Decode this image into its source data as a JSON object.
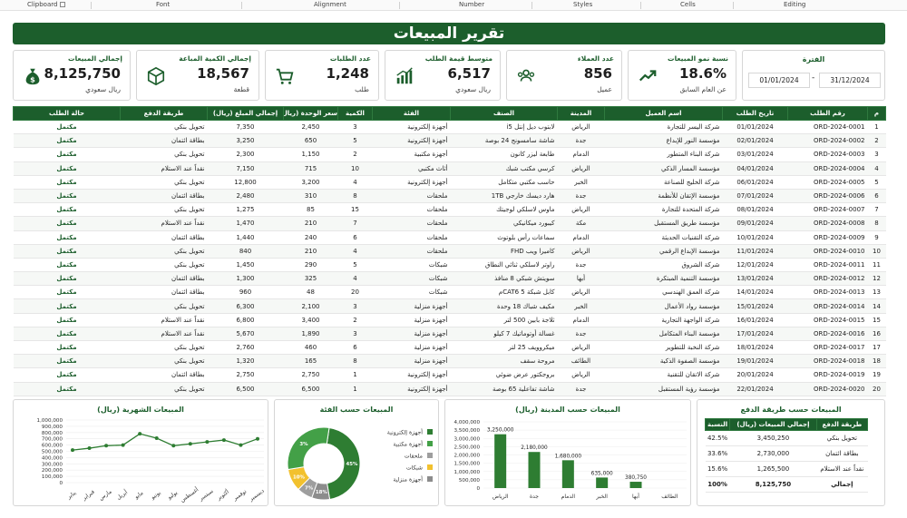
{
  "ribbon": [
    "Clipboard",
    "Font",
    "Alignment",
    "Number",
    "Styles",
    "Cells",
    "Editing"
  ],
  "title": "تقرير المبيعات",
  "period": {
    "label": "الفترة",
    "from": "01/01/2024",
    "to": "31/12/2024",
    "dash": "-"
  },
  "kpis": [
    {
      "title": "نسبة نمو المبيعات",
      "value": "18.6%",
      "sub": "عن العام السابق",
      "icon": "trend-up-icon"
    },
    {
      "title": "عدد العملاء",
      "value": "856",
      "sub": "عميل",
      "icon": "users-icon"
    },
    {
      "title": "متوسط قيمة الطلب",
      "value": "6,517",
      "sub": "ريال سعودي",
      "icon": "bar-trend-icon"
    },
    {
      "title": "عدد الطلبات",
      "value": "1,248",
      "sub": "طلب",
      "icon": "cart-icon"
    },
    {
      "title": "إجمالي الكمية المباعة",
      "value": "18,567",
      "sub": "قطعة",
      "icon": "box-icon"
    },
    {
      "title": "إجمالي المبيعات",
      "value": "8,125,750",
      "sub": "ريال سعودي",
      "icon": "money-bag-icon"
    }
  ],
  "table": {
    "headers": [
      "م",
      "رقم الطلب",
      "تاريخ الطلب",
      "اسم العميل",
      "المدينة",
      "الصنف",
      "الفئة",
      "الكمية",
      "سعر الوحدة (ريال)",
      "إجمالي المبلغ (ريال)",
      "طريقة الدفع",
      "حالة الطلب"
    ],
    "rows": [
      [
        "1",
        "ORD-2024-0001",
        "01/01/2024",
        "شركة اليسر للتجارة",
        "الرياض",
        "لابتوب ديل إنتل i5",
        "أجهزة إلكترونية",
        "3",
        "2,450",
        "7,350",
        "تحويل بنكي",
        "مكتمل"
      ],
      [
        "2",
        "ORD-2024-0002",
        "02/01/2024",
        "مؤسسة النور للإبداع",
        "جدة",
        "شاشة سامسونج 24 بوصة",
        "أجهزة إلكترونية",
        "5",
        "650",
        "3,250",
        "بطاقة ائتمان",
        "مكتمل"
      ],
      [
        "3",
        "ORD-2024-0003",
        "03/01/2024",
        "شركة البناء المتطور",
        "الدمام",
        "طابعة ليزر كانون",
        "أجهزة مكتبية",
        "2",
        "1,150",
        "2,300",
        "تحويل بنكي",
        "مكتمل"
      ],
      [
        "4",
        "ORD-2024-0004",
        "04/01/2024",
        "مؤسسة المسار الذكي",
        "الرياض",
        "كرسي مكتب شبك",
        "أثاث مكتبي",
        "10",
        "715",
        "7,150",
        "نقداً عند الاستلام",
        "مكتمل"
      ],
      [
        "5",
        "ORD-2024-0005",
        "06/01/2024",
        "شركة الخليج للصناعة",
        "الخبر",
        "حاسب مكتبي متكامل",
        "أجهزة إلكترونية",
        "4",
        "3,200",
        "12,800",
        "تحويل بنكي",
        "مكتمل"
      ],
      [
        "6",
        "ORD-2024-0006",
        "07/01/2024",
        "مؤسسة الإتقان للأنظمة",
        "جدة",
        "هارد ديسك خارجي 1TB",
        "ملحقات",
        "8",
        "310",
        "2,480",
        "بطاقة ائتمان",
        "مكتمل"
      ],
      [
        "7",
        "ORD-2024-0007",
        "08/01/2024",
        "شركة المتحدة للتجارة",
        "الرياض",
        "ماوس لاسلكي لوجيتك",
        "ملحقات",
        "15",
        "85",
        "1,275",
        "تحويل بنكي",
        "مكتمل"
      ],
      [
        "8",
        "ORD-2024-0008",
        "09/01/2024",
        "مؤسسة طريق المستقبل",
        "مكة",
        "كيبورد ميكانيكي",
        "ملحقات",
        "7",
        "210",
        "1,470",
        "نقداً عند الاستلام",
        "مكتمل"
      ],
      [
        "9",
        "ORD-2024-0009",
        "10/01/2024",
        "شركة التقنيات الحديثة",
        "الدمام",
        "سماعات رأس بلوتوث",
        "ملحقات",
        "6",
        "240",
        "1,440",
        "بطاقة ائتمان",
        "مكتمل"
      ],
      [
        "10",
        "ORD-2024-0010",
        "11/01/2024",
        "مؤسسة الإبداع الرقمي",
        "الرياض",
        "كاميرا ويب FHD",
        "ملحقات",
        "4",
        "210",
        "840",
        "تحويل بنكي",
        "مكتمل"
      ],
      [
        "11",
        "ORD-2024-0011",
        "12/01/2024",
        "شركة الشروق",
        "جدة",
        "راوتر لاسلكي ثنائي النطاق",
        "شبكات",
        "5",
        "290",
        "1,450",
        "تحويل بنكي",
        "مكتمل"
      ],
      [
        "12",
        "ORD-2024-0012",
        "13/01/2024",
        "مؤسسة التنمية المبتكرة",
        "أبها",
        "سويتش شبكي 8 منافذ",
        "شبكات",
        "4",
        "325",
        "1,300",
        "بطاقة ائتمان",
        "مكتمل"
      ],
      [
        "13",
        "ORD-2024-0013",
        "14/01/2024",
        "شركة العمق الهندسي",
        "الرياض",
        "كابل شبكة CAT6 5م",
        "شبكات",
        "20",
        "48",
        "960",
        "بطاقة ائتمان",
        "مكتمل"
      ],
      [
        "14",
        "ORD-2024-0014",
        "15/01/2024",
        "مؤسسة رواد الأعمال",
        "الخبر",
        "مكيف شباك 18 وحدة",
        "أجهزة منزلية",
        "3",
        "2,100",
        "6,300",
        "تحويل بنكي",
        "مكتمل"
      ],
      [
        "15",
        "ORD-2024-0015",
        "16/01/2024",
        "شركة الواجهة التجارية",
        "الدمام",
        "ثلاجة بابين 500 لتر",
        "أجهزة منزلية",
        "2",
        "3,400",
        "6,800",
        "نقداً عند الاستلام",
        "مكتمل"
      ],
      [
        "16",
        "ORD-2024-0016",
        "17/01/2024",
        "مؤسسة البناء المتكامل",
        "جدة",
        "غسالة أوتوماتيك 7 كيلو",
        "أجهزة منزلية",
        "3",
        "1,890",
        "5,670",
        "نقداً عند الاستلام",
        "مكتمل"
      ],
      [
        "17",
        "ORD-2024-0017",
        "18/01/2024",
        "شركة النخبة للتطوير",
        "الرياض",
        "ميكروويف 25 لتر",
        "أجهزة منزلية",
        "6",
        "460",
        "2,760",
        "تحويل بنكي",
        "مكتمل"
      ],
      [
        "18",
        "ORD-2024-0018",
        "19/01/2024",
        "مؤسسة الصفوة الذكية",
        "الطائف",
        "مروحة سقف",
        "أجهزة منزلية",
        "8",
        "165",
        "1,320",
        "تحويل بنكي",
        "مكتمل"
      ],
      [
        "19",
        "ORD-2024-0019",
        "20/01/2024",
        "شركة الاتقان للتقنية",
        "الرياض",
        "بروجكتور عرض ضوئي",
        "أجهزة إلكترونية",
        "1",
        "2,750",
        "2,750",
        "بطاقة ائتمان",
        "مكتمل"
      ],
      [
        "20",
        "ORD-2024-0020",
        "22/01/2024",
        "مؤسسة رؤية المستقبل",
        "جدة",
        "شاشة تفاعلية 65 بوصة",
        "أجهزة إلكترونية",
        "1",
        "6,500",
        "6,500",
        "تحويل بنكي",
        "مكتمل"
      ]
    ]
  },
  "monthly": {
    "title": "المبيعات الشهرية (ريال)",
    "ytick_labels": [
      "1,000,000",
      "900,000",
      "800,000",
      "700,000",
      "600,000",
      "500,000",
      "400,000",
      "300,000",
      "200,000",
      "100,000",
      "0"
    ],
    "months": [
      "يناير",
      "فبراير",
      "مارس",
      "أبريل",
      "مايو",
      "يونيو",
      "يوليو",
      "أغسطس",
      "سبتمبر",
      "أكتوبر",
      "نوفمبر",
      "ديسمبر"
    ]
  },
  "category": {
    "title": "المبيعات حسب الفئة",
    "legend": [
      "أجهزة إلكترونية",
      "أجهزة مكتبية",
      "ملحقات",
      "شبكات",
      "أجهزة منزلية"
    ],
    "slice_labels": [
      "45%",
      "3%",
      "7%",
      "10%",
      "18%"
    ]
  },
  "city": {
    "title": "المبيعات حسب المدينة (ريال)",
    "ytick_labels": [
      "4,000,000",
      "3,500,000",
      "3,000,000",
      "2,500,000",
      "2,000,000",
      "1,500,000",
      "1,000,000",
      "500,000",
      "0"
    ],
    "value_labels": [
      "3,250,000",
      "2,180,000",
      "1,680,000",
      "635,000",
      "380,750",
      ""
    ]
  },
  "payment": {
    "title": "المبيعات حسب طريقة الدفع",
    "headers": [
      "طريقة الدفع",
      "إجمالي المبيعات (ريال)",
      "النسبة"
    ],
    "rows": [
      [
        "تحويل بنكي",
        "3,450,250",
        "42.5%"
      ],
      [
        "بطاقة ائتمان",
        "2,730,000",
        "33.6%"
      ],
      [
        "نقداً عند الاستلام",
        "1,265,500",
        "15.6%"
      ]
    ],
    "total": [
      "إجمالي",
      "8,125,750",
      "100%"
    ]
  },
  "colors": {
    "primary": "#1c5e2c",
    "green": "#2e7d32",
    "yellow": "#f2c12e",
    "gray": "#9e9e9e"
  },
  "chart_data": [
    {
      "type": "line",
      "title": "المبيعات الشهرية (ريال)",
      "categories": [
        "يناير",
        "فبراير",
        "مارس",
        "أبريل",
        "مايو",
        "يونيو",
        "يوليو",
        "أغسطس",
        "سبتمبر",
        "أكتوبر",
        "نوفمبر",
        "ديسمبر"
      ],
      "values": [
        520000,
        550000,
        590000,
        600000,
        780000,
        710000,
        590000,
        620000,
        650000,
        680000,
        600000,
        700000
      ],
      "ylim": [
        0,
        1000000
      ],
      "grid": true
    },
    {
      "type": "pie",
      "title": "المبيعات حسب الفئة",
      "categories": [
        "أجهزة إلكترونية",
        "أجهزة مكتبية",
        "ملحقات",
        "شبكات",
        "أجهزة منزلية"
      ],
      "values": [
        45,
        3,
        7,
        10,
        18
      ],
      "legend": "right"
    },
    {
      "type": "bar",
      "title": "المبيعات حسب المدينة (ريال)",
      "categories": [
        "الرياض",
        "جدة",
        "الدمام",
        "الخبر",
        "أبها",
        "الطائف"
      ],
      "values": [
        3250000,
        2180000,
        1680000,
        635000,
        380750,
        0
      ],
      "ylim": [
        0,
        4000000
      ],
      "grid": true
    }
  ]
}
